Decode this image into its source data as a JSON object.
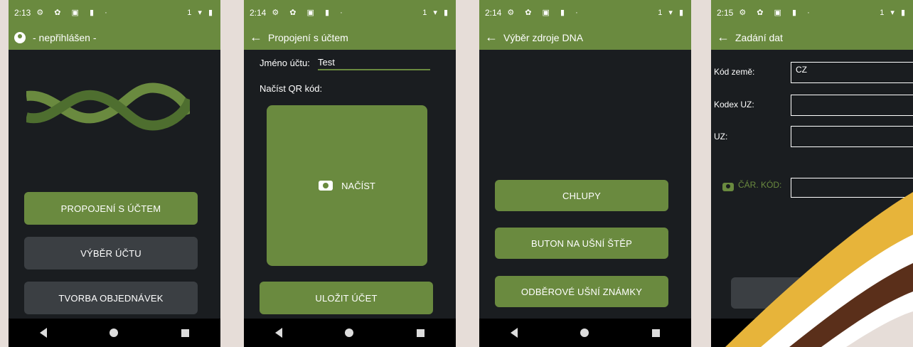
{
  "phone1": {
    "time": "2:13",
    "status_right": "1",
    "title": "- nepřihlášen -",
    "buttons": [
      "PROPOJENÍ S ÚČTEM",
      "VÝBĚR ÚČTU",
      "TVORBA OBJEDNÁVEK"
    ]
  },
  "phone2": {
    "time": "2:14",
    "status_right": "1",
    "title": "Propojení s účtem",
    "account_label": "Jméno účtu:",
    "account_value": "Test",
    "qr_label": "Načíst QR kód:",
    "scan_label": "NAČÍST",
    "save_button": "ULOŽIT ÚČET"
  },
  "phone3": {
    "time": "2:14",
    "status_right": "1",
    "title": "Výběr zdroje DNA",
    "buttons": [
      "CHLUPY",
      "BUTON NA UŠNÍ ŠTĚP",
      "ODBĚROVÉ UŠNÍ ZNÁMKY"
    ]
  },
  "phone4": {
    "time": "2:15",
    "status_right": "1",
    "title": "Zadání dat",
    "fields": [
      {
        "label": "Kód země:",
        "value": "CZ"
      },
      {
        "label": "Kodex UZ:",
        "value": ""
      },
      {
        "label": "UZ:",
        "value": ""
      },
      {
        "label": "ČÁR. KÓD:",
        "value": ""
      }
    ]
  },
  "colors": {
    "accent": "#6a8a3f",
    "screen_bg": "#1a1d20",
    "page_bg": "#e6ddd8",
    "gray_button": "#3b3f43"
  }
}
